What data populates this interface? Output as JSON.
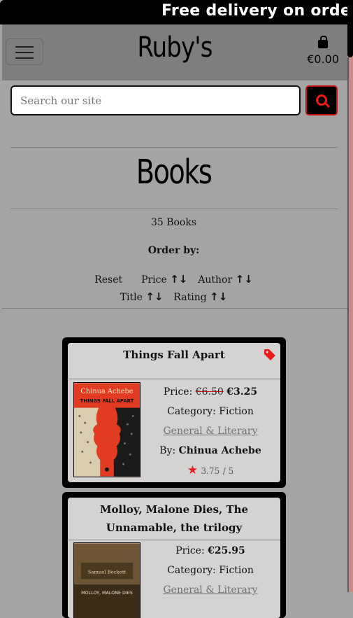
{
  "banner": {
    "text": "Free delivery on orders"
  },
  "navbar": {
    "brand": "Ruby's",
    "cart_total": "€0.00"
  },
  "search": {
    "placeholder": "Search our site"
  },
  "page": {
    "title": "Books",
    "count": "35 Books",
    "order_by": "Order by:",
    "sort": {
      "reset": "Reset",
      "price": "Price",
      "author": "Author",
      "title": "Title",
      "rating": "Rating",
      "arrows": "↑↓"
    }
  },
  "books": [
    {
      "title": "Things Fall Apart",
      "price_label": "Price:",
      "old_price": "€6.50",
      "price": "€3.25",
      "category_label": "Category:",
      "category": "Fiction",
      "subcategory": "General & Literary",
      "by_label": "By:",
      "author": "Chinua Achebe",
      "rating": "3.75",
      "rating_max": "/ 5",
      "cover_author": "Chinua Achebe",
      "cover_title": "THINGS FALL APART",
      "on_sale": true
    },
    {
      "title": "Molloy, Malone Dies, The Unnamable, the trilogy",
      "price_label": "Price:",
      "price": "€25.95",
      "category_label": "Category:",
      "category": "Fiction",
      "subcategory": "General & Literary",
      "cover_author": "Samuel Beckett",
      "cover_title": "MOLLOY, MALONE DIES"
    }
  ]
}
